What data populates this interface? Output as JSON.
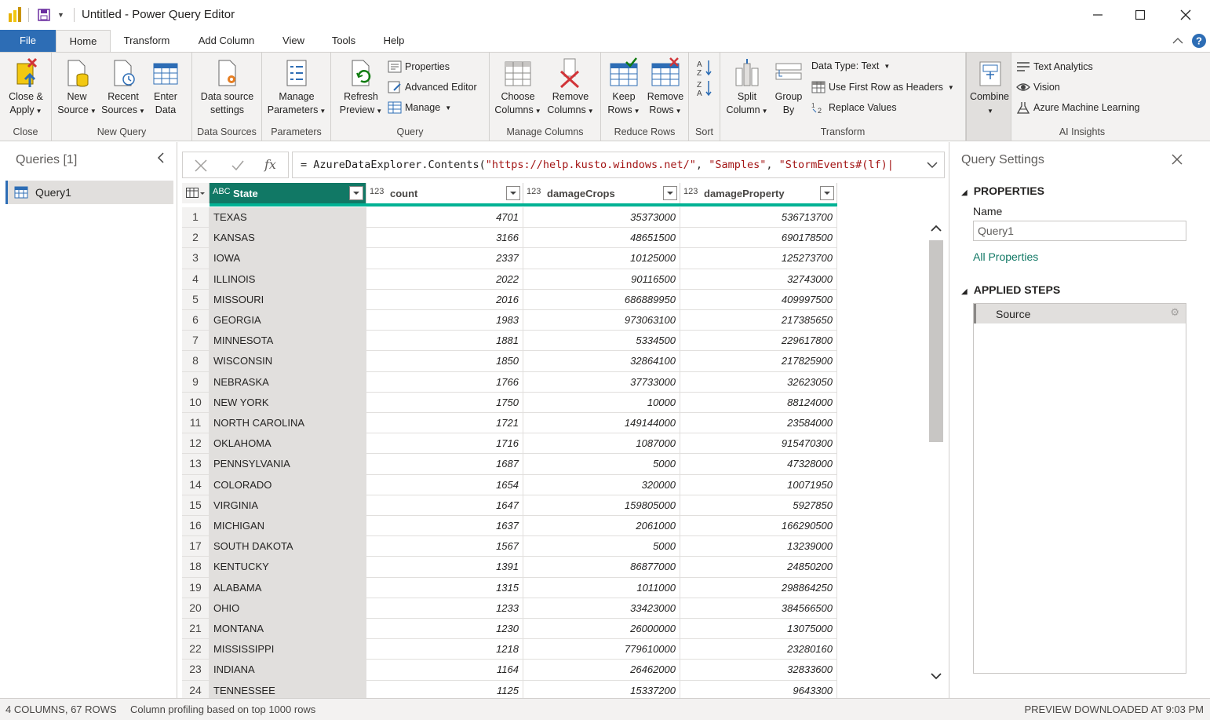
{
  "window": {
    "title": "Untitled - Power Query Editor"
  },
  "tabs": [
    "File",
    "Home",
    "Transform",
    "Add Column",
    "View",
    "Tools",
    "Help"
  ],
  "ribbon": {
    "close": {
      "btn": "Close &",
      "btn2": "Apply",
      "group": "Close"
    },
    "new_query": {
      "new_source": [
        "New",
        "Source"
      ],
      "recent_sources": [
        "Recent",
        "Sources"
      ],
      "enter_data": [
        "Enter",
        "Data"
      ],
      "group": "New Query"
    },
    "data_sources": {
      "btn": [
        "Data source",
        "settings"
      ],
      "group": "Data Sources"
    },
    "parameters": {
      "btn": [
        "Manage",
        "Parameters"
      ],
      "group": "Parameters"
    },
    "query": {
      "refresh": [
        "Refresh",
        "Preview"
      ],
      "properties": "Properties",
      "advanced_editor": "Advanced Editor",
      "manage": "Manage",
      "group": "Query"
    },
    "manage_columns": {
      "choose": [
        "Choose",
        "Columns"
      ],
      "remove": [
        "Remove",
        "Columns"
      ],
      "group": "Manage Columns"
    },
    "reduce_rows": {
      "keep": [
        "Keep",
        "Rows"
      ],
      "remove": [
        "Remove",
        "Rows"
      ],
      "group": "Reduce Rows"
    },
    "sort": {
      "group": "Sort"
    },
    "transform": {
      "split": [
        "Split",
        "Column"
      ],
      "group_by": [
        "Group",
        "By"
      ],
      "data_type": "Data Type: Text",
      "first_row": "Use First Row as Headers",
      "replace": "Replace Values",
      "group": "Transform"
    },
    "combine": {
      "btn": "Combine"
    },
    "ai": {
      "text_analytics": "Text Analytics",
      "vision": "Vision",
      "aml": "Azure Machine Learning",
      "group": "AI Insights"
    }
  },
  "queries": {
    "title": "Queries [1]",
    "items": [
      "Query1"
    ]
  },
  "formula": {
    "prefix": "= AzureDataExplorer.Contents(",
    "arg1": "\"https://help.kusto.windows.net/\"",
    "sep1": ", ",
    "arg2": "\"Samples\"",
    "sep2": ", ",
    "arg3": "\"StormEvents#(lf)|"
  },
  "columns": [
    {
      "type": "ABC",
      "name": "State"
    },
    {
      "type": "123",
      "name": "count"
    },
    {
      "type": "123",
      "name": "damageCrops"
    },
    {
      "type": "123",
      "name": "damageProperty"
    }
  ],
  "rows": [
    [
      "TEXAS",
      "4701",
      "35373000",
      "536713700"
    ],
    [
      "KANSAS",
      "3166",
      "48651500",
      "690178500"
    ],
    [
      "IOWA",
      "2337",
      "10125000",
      "125273700"
    ],
    [
      "ILLINOIS",
      "2022",
      "90116500",
      "32743000"
    ],
    [
      "MISSOURI",
      "2016",
      "686889950",
      "409997500"
    ],
    [
      "GEORGIA",
      "1983",
      "973063100",
      "217385650"
    ],
    [
      "MINNESOTA",
      "1881",
      "5334500",
      "229617800"
    ],
    [
      "WISCONSIN",
      "1850",
      "32864100",
      "217825900"
    ],
    [
      "NEBRASKA",
      "1766",
      "37733000",
      "32623050"
    ],
    [
      "NEW YORK",
      "1750",
      "10000",
      "88124000"
    ],
    [
      "NORTH CAROLINA",
      "1721",
      "149144000",
      "23584000"
    ],
    [
      "OKLAHOMA",
      "1716",
      "1087000",
      "915470300"
    ],
    [
      "PENNSYLVANIA",
      "1687",
      "5000",
      "47328000"
    ],
    [
      "COLORADO",
      "1654",
      "320000",
      "10071950"
    ],
    [
      "VIRGINIA",
      "1647",
      "159805000",
      "5927850"
    ],
    [
      "MICHIGAN",
      "1637",
      "2061000",
      "166290500"
    ],
    [
      "SOUTH DAKOTA",
      "1567",
      "5000",
      "13239000"
    ],
    [
      "KENTUCKY",
      "1391",
      "86877000",
      "24850200"
    ],
    [
      "ALABAMA",
      "1315",
      "1011000",
      "298864250"
    ],
    [
      "OHIO",
      "1233",
      "33423000",
      "384566500"
    ],
    [
      "MONTANA",
      "1230",
      "26000000",
      "13075000"
    ],
    [
      "MISSISSIPPI",
      "1218",
      "779610000",
      "23280160"
    ],
    [
      "INDIANA",
      "1164",
      "26462000",
      "32833600"
    ],
    [
      "TENNESSEE",
      "1125",
      "15337200",
      "9643300"
    ]
  ],
  "settings": {
    "title": "Query Settings",
    "properties": "PROPERTIES",
    "name_label": "Name",
    "name_value": "Query1",
    "all_properties": "All Properties",
    "applied_steps": "APPLIED STEPS",
    "steps": [
      "Source"
    ]
  },
  "status": {
    "left": "4 COLUMNS, 67 ROWS",
    "profiling": "Column profiling based on top 1000 rows",
    "right": "PREVIEW DOWNLOADED AT 9:03 PM"
  },
  "colors": {
    "accent": "#2d6db5",
    "quality": "#00b294",
    "header_selected": "#117865"
  }
}
